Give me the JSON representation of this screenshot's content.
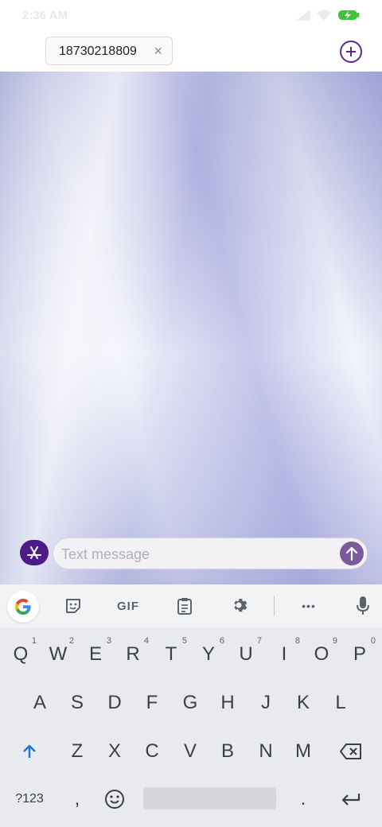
{
  "status": {
    "time": "2:36 AM"
  },
  "header": {
    "recipient": "18730218809",
    "remove_glyph": "×"
  },
  "compose": {
    "placeholder": "Text message"
  },
  "keyboard": {
    "toolbar": {
      "gif_label": "GIF",
      "more_glyph": "•••"
    },
    "row1": [
      "Q",
      "W",
      "E",
      "R",
      "T",
      "Y",
      "U",
      "I",
      "O",
      "P"
    ],
    "row1_hints": [
      "1",
      "2",
      "3",
      "4",
      "5",
      "6",
      "7",
      "8",
      "9",
      "0"
    ],
    "row2": [
      "A",
      "S",
      "D",
      "F",
      "G",
      "H",
      "J",
      "K",
      "L"
    ],
    "row3": [
      "Z",
      "X",
      "C",
      "V",
      "B",
      "N",
      "M"
    ],
    "bottom": {
      "symbols_label": "?123",
      "comma": ",",
      "period": "."
    }
  },
  "colors": {
    "accent": "#4d1a88",
    "send": "#7b5a99",
    "battery": "#3dc43d"
  }
}
